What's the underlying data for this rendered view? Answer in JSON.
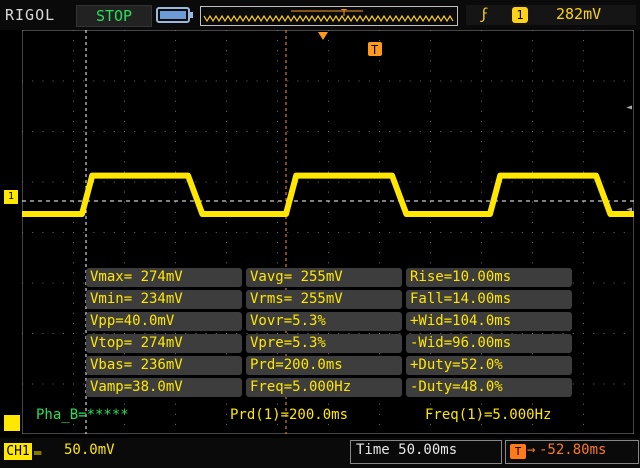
{
  "header": {
    "brand": "RIGOL",
    "run_status": "STOP",
    "trigger_source": "1",
    "trigger_level": "282mV",
    "trigger_marker": "T"
  },
  "colors": {
    "ch1": "#ffe700",
    "status": "#27e05a",
    "trigger": "#ff9a1a"
  },
  "icons": {
    "battery": "battery-icon",
    "trigger_edge": "rising-edge-icon",
    "trigger_position": "trigger-position-icon"
  },
  "waveform": {
    "period_ms": 200,
    "duty_percent": 52,
    "rise_ms": 10,
    "fall_ms": 14,
    "vtop_mV": 274,
    "vbase_mV": 236,
    "scale_mV_per_div": 50,
    "timebase_ms_per_div": 50
  },
  "measurements": [
    [
      "Vmax= 274mV",
      "Vavg= 255mV",
      "Rise=10.00ms"
    ],
    [
      "Vmin= 234mV",
      "Vrms= 255mV",
      "Fall=14.00ms"
    ],
    [
      "Vpp=40.0mV",
      "Vovr=5.3%",
      "+Wid=104.0ms"
    ],
    [
      "Vtop= 274mV",
      "Vpre=5.3%",
      "-Wid=96.00ms"
    ],
    [
      "Vbas= 236mV",
      "Prd=200.0ms",
      "+Duty=52.0%"
    ],
    [
      "Vamp=38.0mV",
      "Freq=5.000Hz",
      "-Duty=48.0%"
    ]
  ],
  "footer_info": {
    "phase": "Pha_B=*****",
    "period1": "Prd(1)=200.0ms",
    "freq1": "Freq(1)=5.000Hz"
  },
  "status_bar": {
    "channel": "CH1",
    "scale": "50.0mV",
    "timebase": "Time 50.00ms",
    "delay": "-52.80ms"
  }
}
